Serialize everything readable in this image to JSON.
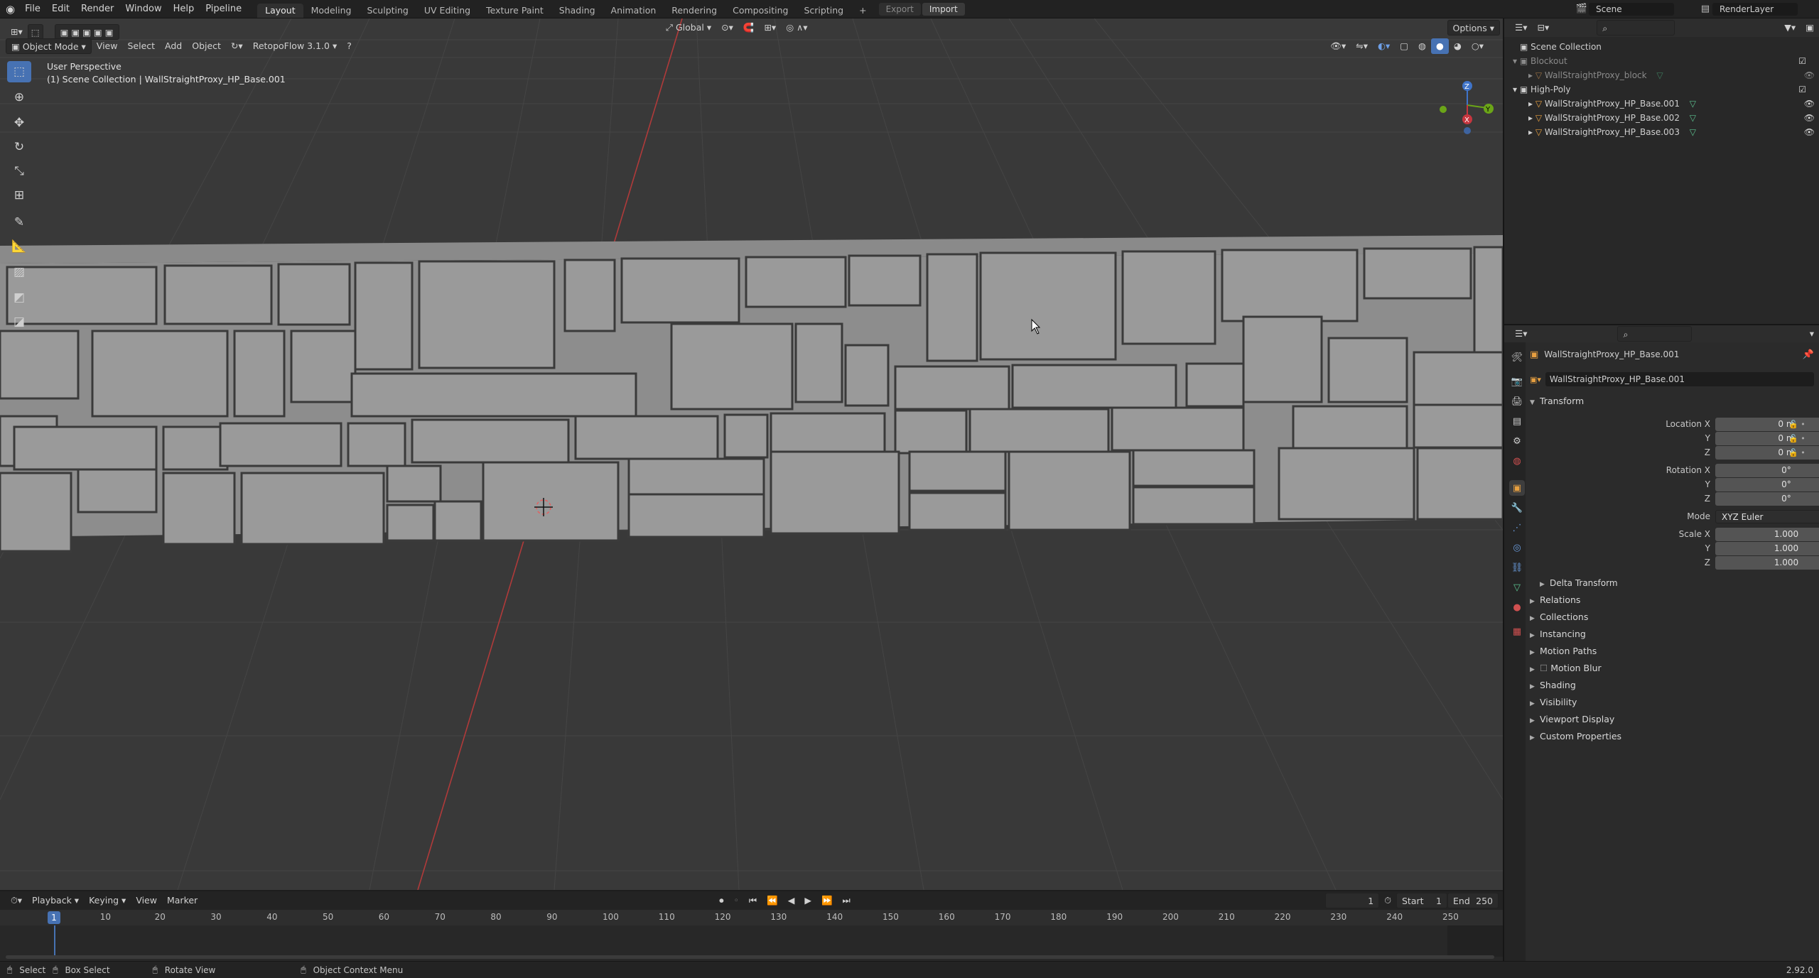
{
  "menu": {
    "items": [
      "File",
      "Edit",
      "Render",
      "Window",
      "Help",
      "Pipeline"
    ],
    "workspaces": [
      "Layout",
      "Modeling",
      "Sculpting",
      "UV Editing",
      "Texture Paint",
      "Shading",
      "Animation",
      "Rendering",
      "Compositing",
      "Scripting"
    ],
    "active_workspace": "Layout",
    "export_label": "Export",
    "import_label": "Import",
    "scene": "Scene",
    "view_layer": "RenderLayer"
  },
  "viewport_header": {
    "mode": "Object Mode",
    "view": "View",
    "select": "Select",
    "add": "Add",
    "object": "Object",
    "addon": "RetopoFlow 3.1.0",
    "orientation": "Global",
    "options": "Options"
  },
  "overlay": {
    "perspective": "User Perspective",
    "collection": "(1) Scene Collection | WallStraightProxy_HP_Base.001"
  },
  "outliner": {
    "root": "Scene Collection",
    "items": [
      {
        "label": "Blockout",
        "type": "collection",
        "dim": true
      },
      {
        "label": "WallStraightProxy_block",
        "type": "object",
        "dim": true
      },
      {
        "label": "High-Poly",
        "type": "collection",
        "dim": false
      },
      {
        "label": "WallStraightProxy_HP_Base.001",
        "type": "object",
        "dim": false
      },
      {
        "label": "WallStraightProxy_HP_Base.002",
        "type": "object",
        "dim": false
      },
      {
        "label": "WallStraightProxy_HP_Base.003",
        "type": "object",
        "dim": false
      }
    ]
  },
  "properties": {
    "object_name": "WallStraightProxy_HP_Base.001",
    "object_field": "WallStraightProxy_HP_Base.001",
    "transform_title": "Transform",
    "location_label": "Location X",
    "location": [
      "0 m",
      "0 m",
      "0 m"
    ],
    "rotation_label": "Rotation X",
    "rotation": [
      "0°",
      "0°",
      "0°"
    ],
    "mode_label": "Mode",
    "mode_value": "XYZ Euler",
    "scale_label": "Scale X",
    "scale": [
      "1.000",
      "1.000",
      "1.000"
    ],
    "y_label": "Y",
    "z_label": "Z",
    "delta": "Delta Transform",
    "panels": [
      "Relations",
      "Collections",
      "Instancing",
      "Motion Paths",
      "Motion Blur",
      "Shading",
      "Visibility",
      "Viewport Display",
      "Custom Properties"
    ]
  },
  "timeline": {
    "playback": "Playback",
    "keying": "Keying",
    "view": "View",
    "marker": "Marker",
    "current_frame": "1",
    "start_label": "Start",
    "start": "1",
    "end_label": "End",
    "end": "250",
    "ticks": [
      "10",
      "20",
      "30",
      "40",
      "50",
      "60",
      "70",
      "80",
      "90",
      "100",
      "110",
      "120",
      "130",
      "140",
      "150",
      "160",
      "170",
      "180",
      "190",
      "200",
      "210",
      "220",
      "230",
      "240",
      "250"
    ],
    "frame_marker": "1"
  },
  "status": {
    "select": "Select",
    "box_select": "Box Select",
    "rotate": "Rotate View",
    "context": "Object Context Menu",
    "version": "2.92.0"
  },
  "colors": {
    "accent": "#4772b3",
    "x_axis": "#c6363f",
    "y_axis": "#6ba518",
    "z_axis": "#3f74c9",
    "object_orange": "#e8a040",
    "mesh_green": "#5cc28f"
  }
}
